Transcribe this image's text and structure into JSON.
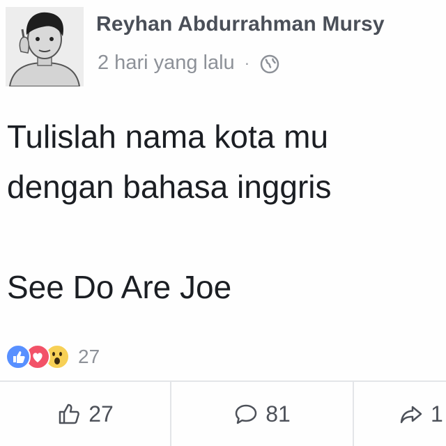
{
  "post": {
    "author_name": "Reyhan Abdurrahman Mursy",
    "timestamp": "2 hari yang lalu",
    "separator": "·",
    "privacy_icon": "globe-icon",
    "body_lines": [
      "Tulislah nama kota mu",
      "dengan bahasa inggris",
      "",
      "See Do Are Joe"
    ],
    "reactions": {
      "types": [
        "like",
        "love",
        "wow"
      ],
      "count": "27"
    },
    "actions": {
      "like_count": "27",
      "comment_count": "81",
      "share_count": "1"
    }
  },
  "colors": {
    "like_blue": "#5890ff",
    "love_red": "#f25268",
    "wow_yellow": "#f7d056",
    "text_dark": "#1b1e23",
    "text_muted": "#8d9198"
  }
}
